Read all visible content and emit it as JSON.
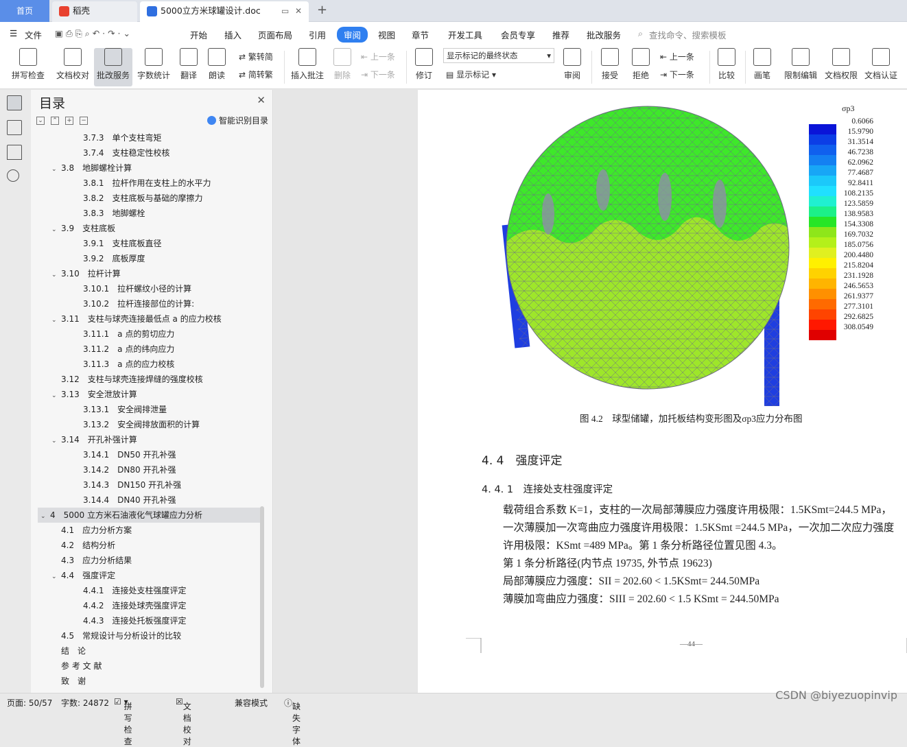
{
  "tabs": {
    "home": "首页",
    "tab1": "稻壳",
    "tab2": "5000立方米球罐设计.doc",
    "new_tab": "+"
  },
  "menu": {
    "file": "文件",
    "items": [
      "开始",
      "插入",
      "页面布局",
      "引用",
      "审阅",
      "视图",
      "章节",
      "开发工具",
      "会员专享",
      "推荐",
      "批改服务"
    ],
    "active": "审阅",
    "search": "查找命令、搜索模板"
  },
  "ribbon": {
    "spell": "拼写检查",
    "proof": "文档校对",
    "grade": "批改服务",
    "wordcount": "字数统计",
    "translate": "翻译",
    "read": "朗读",
    "trad": "繁转简",
    "simp": "简转繁",
    "insert_comment": "插入批注",
    "delete": "删除",
    "prev": "上一条",
    "next": "下一条",
    "revise": "修订",
    "markup_state": "显示标记的最终状态",
    "show_markup": "显示标记",
    "review": "审阅",
    "accept": "接受",
    "reject": "拒绝",
    "prev2": "上一条",
    "next2": "下一条",
    "compare": "比较",
    "pen": "画笔",
    "restrict": "限制编辑",
    "perm": "文档权限",
    "cert": "文档认证"
  },
  "toc": {
    "title": "目录",
    "ai_label": "智能识别目录",
    "items": [
      {
        "text": "3.7.3　单个支柱弯矩",
        "level": 3
      },
      {
        "text": "3.7.4　支柱稳定性校核",
        "level": 3
      },
      {
        "text": "3.8　地脚螺栓计算",
        "level": 2,
        "caret": true
      },
      {
        "text": "3.8.1　拉杆作用在支柱上的水平力",
        "level": 3
      },
      {
        "text": "3.8.2　支柱底板与基础的摩擦力",
        "level": 3
      },
      {
        "text": "3.8.3　地脚螺栓",
        "level": 3
      },
      {
        "text": "3.9　支柱底板",
        "level": 2,
        "caret": true
      },
      {
        "text": "3.9.1　支柱底板直径",
        "level": 3
      },
      {
        "text": "3.9.2　底板厚度",
        "level": 3
      },
      {
        "text": "3.10　拉杆计算",
        "level": 2,
        "caret": true
      },
      {
        "text": "3.10.1　拉杆螺纹小径的计算",
        "level": 3
      },
      {
        "text": "3.10.2　拉杆连接部位的计算:",
        "level": 3
      },
      {
        "text": "3.11　支柱与球壳连接最低点 a 的应力校核",
        "level": 2,
        "caret": true
      },
      {
        "text": "3.11.1　a 点的剪切应力",
        "level": 3
      },
      {
        "text": "3.11.2　a 点的纬向应力",
        "level": 3
      },
      {
        "text": "3.11.3　a 点的应力校核",
        "level": 3
      },
      {
        "text": "3.12　支柱与球壳连接焊缝的强度校核",
        "level": 2
      },
      {
        "text": "3.13　安全泄放计算",
        "level": 2,
        "caret": true
      },
      {
        "text": "3.13.1　安全阀排泄量",
        "level": 3
      },
      {
        "text": "3.13.2　安全阀排放面积的计算",
        "level": 3
      },
      {
        "text": "3.14　开孔补强计算",
        "level": 2,
        "caret": true
      },
      {
        "text": "3.14.1　DN50 开孔补强",
        "level": 3
      },
      {
        "text": "3.14.2　DN80 开孔补强",
        "level": 3
      },
      {
        "text": "3.14.3　DN150 开孔补强",
        "level": 3
      },
      {
        "text": "3.14.4　DN40 开孔补强",
        "level": 3
      },
      {
        "text": "4　5000 立方米石油液化气球罐应力分析",
        "level": 1,
        "caret": true,
        "selected": true
      },
      {
        "text": "4.1　应力分析方案",
        "level": 2
      },
      {
        "text": "4.2　结构分析",
        "level": 2
      },
      {
        "text": "4.3　应力分析结果",
        "level": 2
      },
      {
        "text": "4.4　强度评定",
        "level": 2,
        "caret": true
      },
      {
        "text": "4.4.1　连接处支柱强度评定",
        "level": 3
      },
      {
        "text": "4.4.2　连接处球壳强度评定",
        "level": 3
      },
      {
        "text": "4.4.3　连接处托板强度评定",
        "level": 3
      },
      {
        "text": "4.5　常规设计与分析设计的比较",
        "level": 2
      },
      {
        "text": "结　论",
        "level": 0
      },
      {
        "text": "参 考 文 献",
        "level": 0
      },
      {
        "text": "致　谢",
        "level": 0
      }
    ]
  },
  "legend": {
    "title": "σp3",
    "values": [
      "0.6066",
      "15.9790",
      "31.3514",
      "46.7238",
      "62.0962",
      "77.4687",
      "92.8411",
      "108.2135",
      "123.5859",
      "138.9583",
      "154.3308",
      "169.7032",
      "185.0756",
      "200.4480",
      "215.8204",
      "231.1928",
      "246.5653",
      "261.9377",
      "277.3101",
      "292.6825",
      "308.0549"
    ],
    "colors": [
      "#0a14d8",
      "#0c3ee6",
      "#1060ee",
      "#1480f2",
      "#18a6f6",
      "#1cc8fa",
      "#20e0ff",
      "#20f0d0",
      "#1cf088",
      "#26e626",
      "#8ee61a",
      "#b4f01a",
      "#e0f020",
      "#fff000",
      "#ffd200",
      "#ffb400",
      "#ff9000",
      "#ff6a00",
      "#ff4400",
      "#ff1800",
      "#e00000"
    ]
  },
  "doc": {
    "caption": "图 4.2　球型储罐，加托板结构变形图及σp3应力分布图",
    "h2": "4. 4　强度评定",
    "h3": "4. 4. 1　连接处支柱强度评定",
    "p1": "载荷组合系数 K=1，支柱的一次局部薄膜应力强度许用极限：1.5KSmt=244.5 MPa，一次薄膜加一次弯曲应力强度许用极限：1.5KSmt =244.5 MPa，一次加二次应力强度许用极限：KSmt =489 MPa。第 1 条分析路径位置见图 4.3。",
    "p2": "第 1 条分析路径(内节点 19735, 外节点 19623)",
    "p3": "局部薄膜应力强度：SII = 202.60 < 1.5KSmt= 244.50MPa",
    "p4": "薄膜加弯曲应力强度：SIII = 202.60 < 1.5 KSmt = 244.50MPa",
    "page_number": "—44—"
  },
  "status": {
    "page": "页面: 50/57",
    "words": "字数: 24872",
    "spell": "拼写检查",
    "proof": "文档校对",
    "compat": "兼容模式",
    "missing_font": "缺失字体"
  },
  "watermark": "CSDN @biyezuopinvip"
}
